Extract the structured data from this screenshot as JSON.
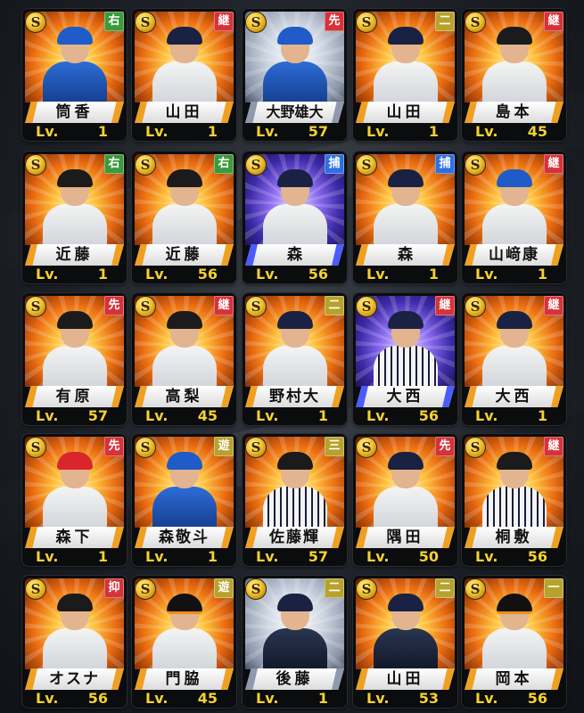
{
  "colors": {
    "level_text": "#f5d230",
    "position_badge": {
      "右": "#3c9a3c",
      "継": "#d6323a",
      "先": "#d6323a",
      "二": "#b8a22e",
      "捕": "#2f6fe0",
      "遊": "#b8a22e",
      "三": "#b8a22e",
      "抑": "#d6323a",
      "一": "#b8a22e"
    }
  },
  "icons": {
    "rarity": "s-coin-icon"
  },
  "rarity_letter": "S",
  "level_label": "Lv.",
  "cards": [
    {
      "name": "筒香",
      "level": "1",
      "position": "右",
      "bg": "gold",
      "team": "blue",
      "cap": "blue"
    },
    {
      "name": "山田",
      "level": "1",
      "position": "継",
      "bg": "gold",
      "team": "white",
      "cap": "navy"
    },
    {
      "name": "大野雄大",
      "level": "57",
      "position": "先",
      "bg": "silver",
      "team": "blue",
      "cap": "blue"
    },
    {
      "name": "山田",
      "level": "1",
      "position": "二",
      "bg": "gold",
      "team": "white",
      "cap": "navy"
    },
    {
      "name": "島本",
      "level": "45",
      "position": "継",
      "bg": "gold",
      "team": "white",
      "cap": "black"
    },
    {
      "name": "近藤",
      "level": "1",
      "position": "右",
      "bg": "gold",
      "team": "white",
      "cap": "black"
    },
    {
      "name": "近藤",
      "level": "56",
      "position": "右",
      "bg": "gold",
      "team": "white",
      "cap": "black"
    },
    {
      "name": "森",
      "level": "56",
      "position": "捕",
      "bg": "purple",
      "team": "white",
      "cap": "navy"
    },
    {
      "name": "森",
      "level": "1",
      "position": "捕",
      "bg": "gold",
      "team": "white",
      "cap": "navy"
    },
    {
      "name": "山﨑康",
      "level": "1",
      "position": "継",
      "bg": "gold",
      "team": "white",
      "cap": "blue"
    },
    {
      "name": "有原",
      "level": "57",
      "position": "先",
      "bg": "gold",
      "team": "white",
      "cap": "black"
    },
    {
      "name": "高梨",
      "level": "45",
      "position": "継",
      "bg": "gold",
      "team": "white",
      "cap": "black"
    },
    {
      "name": "野村大",
      "level": "1",
      "position": "二",
      "bg": "gold",
      "team": "white",
      "cap": "navy"
    },
    {
      "name": "大西",
      "level": "56",
      "position": "継",
      "bg": "purple",
      "team": "stripe",
      "cap": "navy"
    },
    {
      "name": "大西",
      "level": "1",
      "position": "継",
      "bg": "gold",
      "team": "white",
      "cap": "navy"
    },
    {
      "name": "森下",
      "level": "1",
      "position": "先",
      "bg": "gold",
      "team": "white",
      "cap": "red"
    },
    {
      "name": "森敬斗",
      "level": "1",
      "position": "遊",
      "bg": "gold",
      "team": "blue",
      "cap": "blue"
    },
    {
      "name": "佐藤輝",
      "level": "57",
      "position": "三",
      "bg": "gold",
      "team": "stripe",
      "cap": "black"
    },
    {
      "name": "隅田",
      "level": "50",
      "position": "先",
      "bg": "gold",
      "team": "white",
      "cap": "navy"
    },
    {
      "name": "桐敷",
      "level": "56",
      "position": "継",
      "bg": "gold",
      "team": "stripe",
      "cap": "black"
    },
    {
      "name": "オスナ",
      "level": "56",
      "position": "抑",
      "bg": "gold",
      "team": "white",
      "cap": "black"
    },
    {
      "name": "門脇",
      "level": "45",
      "position": "遊",
      "bg": "gold",
      "team": "white",
      "cap": "orange"
    },
    {
      "name": "後藤",
      "level": "1",
      "position": "二",
      "bg": "silver",
      "team": "navy",
      "cap": "navy"
    },
    {
      "name": "山田",
      "level": "53",
      "position": "二",
      "bg": "gold",
      "team": "navy",
      "cap": "navy"
    },
    {
      "name": "岡本",
      "level": "56",
      "position": "一",
      "bg": "gold",
      "team": "white",
      "cap": "orange"
    }
  ]
}
